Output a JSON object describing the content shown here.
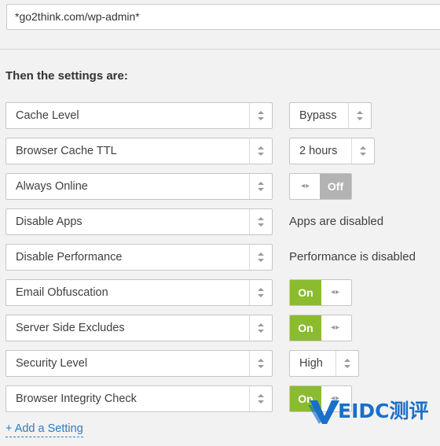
{
  "url_field": {
    "value": "*go2think.com/wp-admin*"
  },
  "heading": "Then the settings are:",
  "settings": [
    {
      "name": "Cache Level",
      "value_type": "select",
      "value": "Bypass"
    },
    {
      "name": "Browser Cache TTL",
      "value_type": "select",
      "value": "2 hours"
    },
    {
      "name": "Always Online",
      "value_type": "toggle",
      "state": "Off",
      "label": "Off"
    },
    {
      "name": "Disable Apps",
      "value_type": "text",
      "value": "Apps are disabled"
    },
    {
      "name": "Disable Performance",
      "value_type": "text",
      "value": "Performance is disabled"
    },
    {
      "name": "Email Obfuscation",
      "value_type": "toggle",
      "state": "On",
      "label": "On"
    },
    {
      "name": "Server Side Excludes",
      "value_type": "toggle",
      "state": "On",
      "label": "On"
    },
    {
      "name": "Security Level",
      "value_type": "select",
      "value": "High"
    },
    {
      "name": "Browser Integrity Check",
      "value_type": "toggle",
      "state": "On",
      "label": "On"
    }
  ],
  "add_setting_link": "+ Add a Setting",
  "watermark": {
    "text": "EIDC测评"
  },
  "colors": {
    "toggle_on": "#8bbc2f",
    "toggle_off": "#b3b3b3",
    "link": "#2f7bbf",
    "watermark": "#1a6fc9"
  }
}
